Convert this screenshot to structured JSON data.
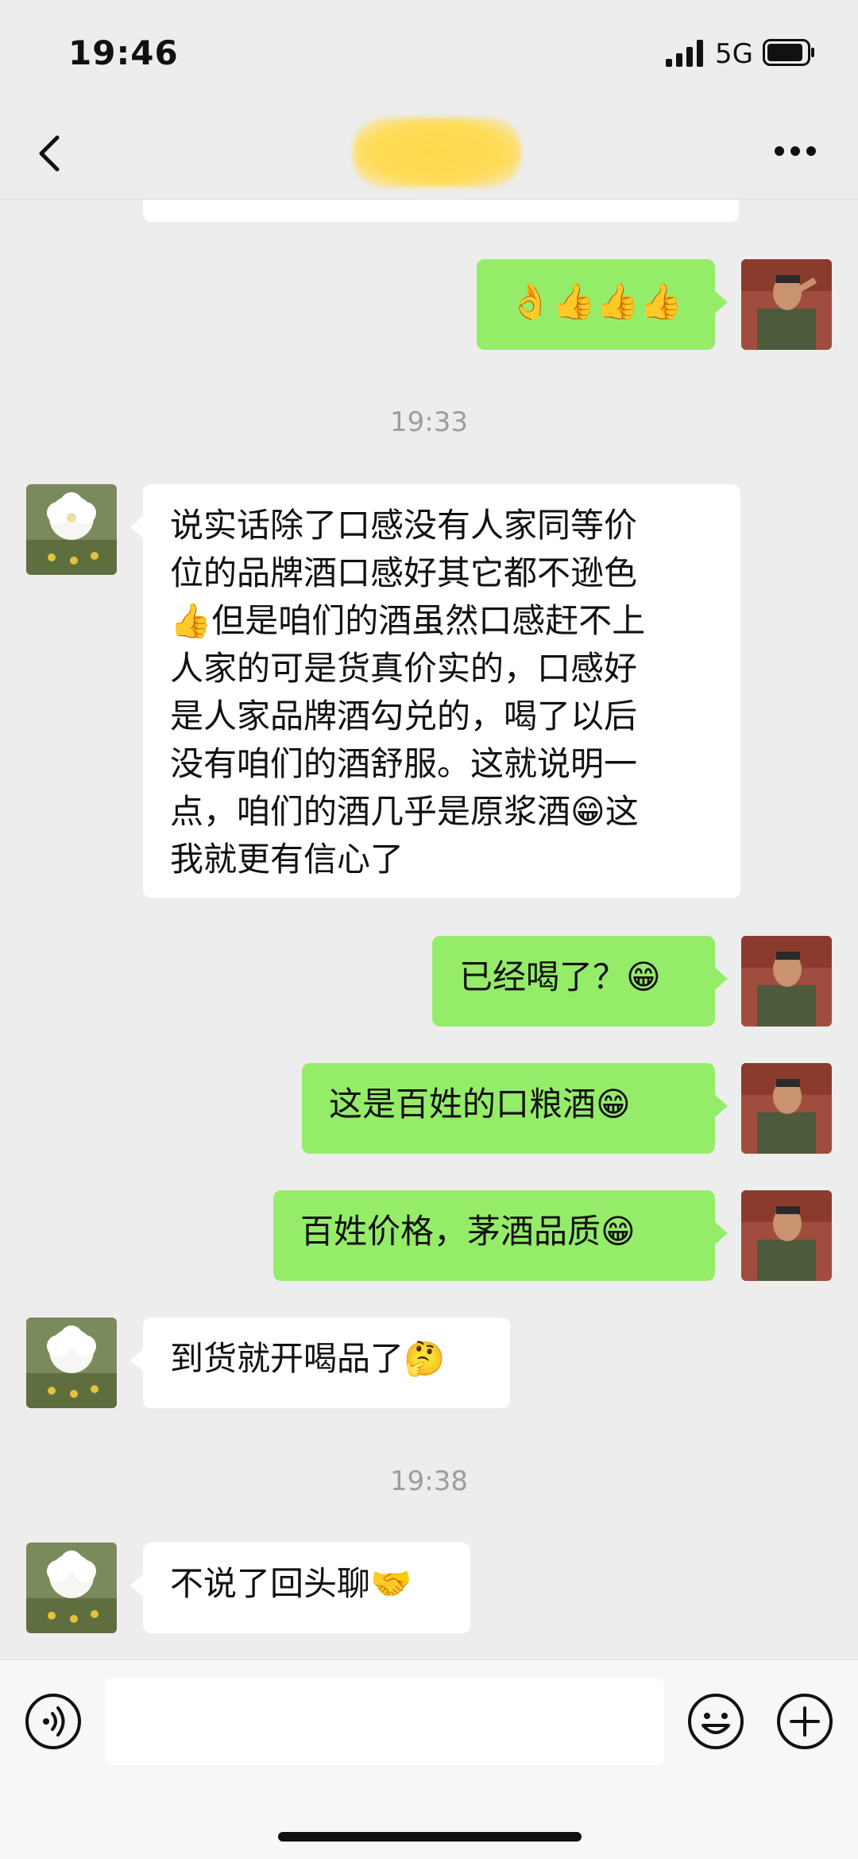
{
  "status_bar": {
    "time": "19:46",
    "network": "5G"
  },
  "messages": [
    {
      "side": "right",
      "text": "👌👍👍👍"
    },
    {
      "timestamp": "19:33"
    },
    {
      "side": "left",
      "lines": [
        "说实话除了口感没有人家同等价",
        "位的品牌酒口感好其它都不逊色",
        "👍但是咱们的酒虽然口感赶不上",
        "人家的可是货真价实的，口感好",
        "是人家品牌酒勾兑的，喝了以后",
        "没有咱们的酒舒服。这就说明一",
        "点，咱们的酒几乎是原浆酒😁这",
        "我就更有信心了"
      ]
    },
    {
      "side": "right",
      "text": "已经喝了？😁"
    },
    {
      "side": "right",
      "text": "这是百姓的口粮酒😁"
    },
    {
      "side": "right",
      "text": "百姓价格，茅酒品质😁"
    },
    {
      "side": "left",
      "text": "到货就开喝品了🤔"
    },
    {
      "timestamp": "19:38"
    },
    {
      "side": "left",
      "text": "不说了回头聊🤝"
    }
  ],
  "icons": {
    "back": "chevron-left-icon",
    "more": "more-dots-icon",
    "voice": "voice-icon",
    "emoji": "smiley-icon",
    "add": "plus-icon"
  },
  "colors": {
    "own_bubble": "#95ec69",
    "other_bubble": "#ffffff",
    "background": "#ededed"
  }
}
